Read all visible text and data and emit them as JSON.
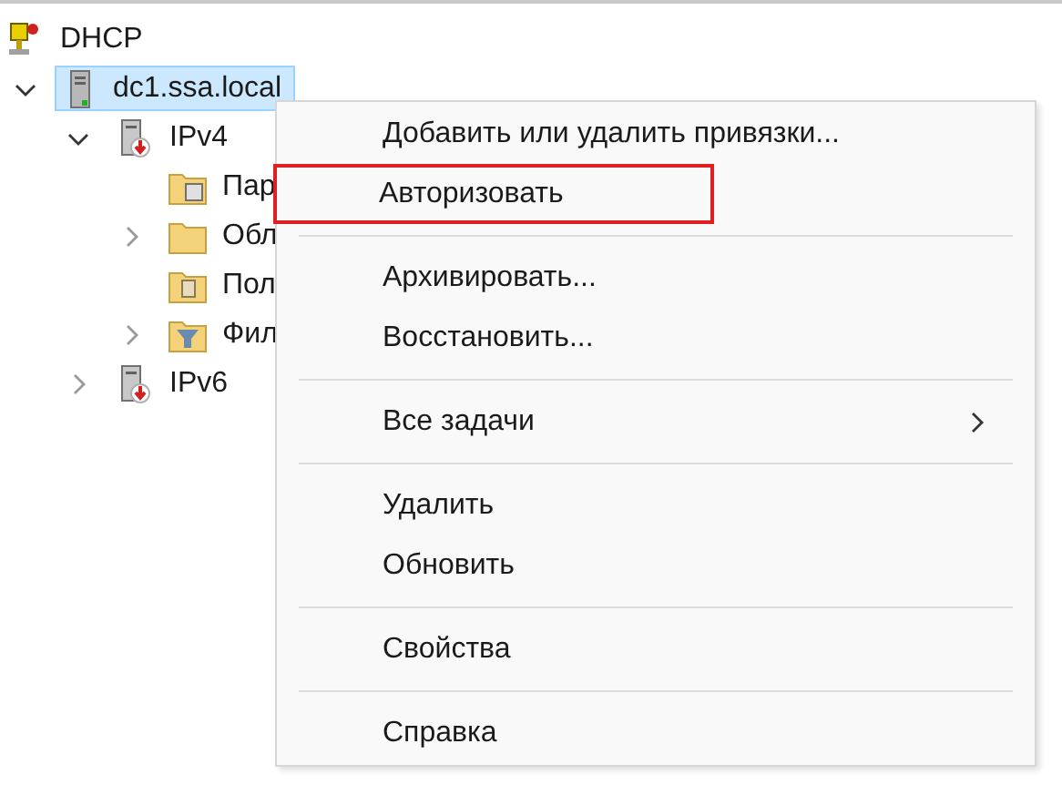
{
  "tree": {
    "label": "DHCP",
    "kind": "root",
    "children": [
      {
        "label": "dc1.ssa.local",
        "kind": "server",
        "selected": true,
        "expanded": true,
        "children": [
          {
            "label": "IPv4",
            "kind": "protocol",
            "selected": false,
            "expanded": true,
            "children": [
              {
                "label": "Пар",
                "kind": "pool",
                "selected": false
              },
              {
                "label": "Обл",
                "kind": "folder",
                "selected": false,
                "expanded": false
              },
              {
                "label": "Пол",
                "kind": "policy",
                "selected": false
              },
              {
                "label": "Фил",
                "kind": "filter",
                "selected": false,
                "expanded": false
              }
            ]
          },
          {
            "label": "IPv6",
            "kind": "protocol",
            "selected": false,
            "expanded": false
          }
        ]
      }
    ]
  },
  "context_menu": [
    {
      "kind": "item",
      "label": "Добавить или удалить привязки...",
      "highlighted": false
    },
    {
      "kind": "item",
      "label": "Авторизовать",
      "highlighted": true
    },
    {
      "kind": "separator"
    },
    {
      "kind": "item",
      "label": "Архивировать...",
      "highlighted": false
    },
    {
      "kind": "item",
      "label": "Восстановить...",
      "highlighted": false
    },
    {
      "kind": "separator"
    },
    {
      "kind": "item",
      "label": "Все задачи",
      "highlighted": false,
      "submenu": true
    },
    {
      "kind": "separator"
    },
    {
      "kind": "item",
      "label": "Удалить",
      "highlighted": false
    },
    {
      "kind": "item",
      "label": "Обновить",
      "highlighted": false
    },
    {
      "kind": "separator"
    },
    {
      "kind": "item",
      "label": "Свойства",
      "highlighted": false
    },
    {
      "kind": "separator"
    },
    {
      "kind": "item",
      "label": "Справка",
      "highlighted": false
    }
  ]
}
